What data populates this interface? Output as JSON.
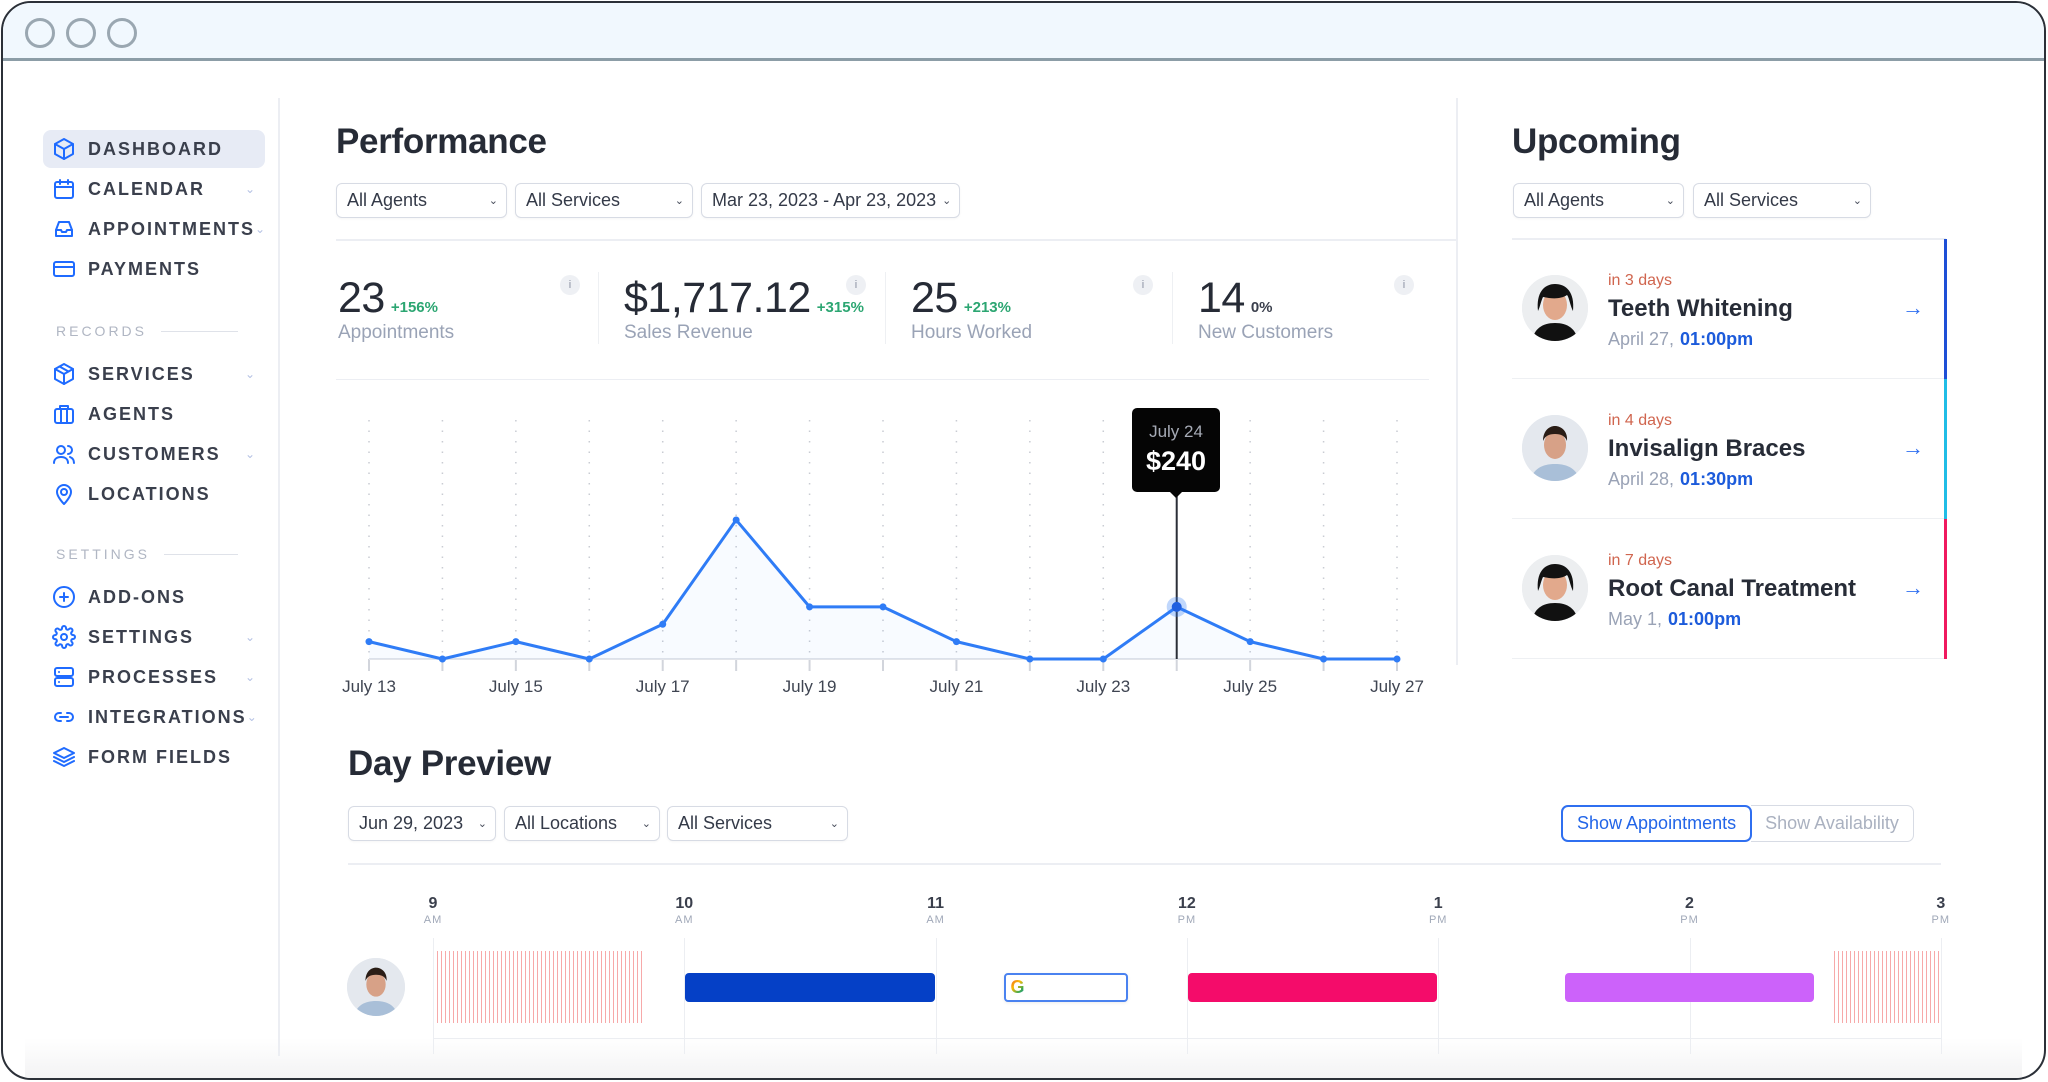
{
  "window": {
    "controls": [
      "close",
      "minimize",
      "maximize"
    ]
  },
  "sidebar": {
    "items": [
      {
        "label": "DASHBOARD",
        "icon": "cube-icon",
        "active": true,
        "has_submenu": false
      },
      {
        "label": "CALENDAR",
        "icon": "calendar-icon",
        "active": false,
        "has_submenu": true
      },
      {
        "label": "APPOINTMENTS",
        "icon": "inbox-icon",
        "active": false,
        "has_submenu": true
      },
      {
        "label": "PAYMENTS",
        "icon": "credit-card-icon",
        "active": false,
        "has_submenu": false
      }
    ],
    "records_heading": "RECORDS",
    "records_items": [
      {
        "label": "SERVICES",
        "icon": "box-icon",
        "has_submenu": true
      },
      {
        "label": "AGENTS",
        "icon": "briefcase-icon",
        "has_submenu": false
      },
      {
        "label": "CUSTOMERS",
        "icon": "users-icon",
        "has_submenu": true
      },
      {
        "label": "LOCATIONS",
        "icon": "map-pin-icon",
        "has_submenu": false
      }
    ],
    "settings_heading": "SETTINGS",
    "settings_items": [
      {
        "label": "ADD-ONS",
        "icon": "plus-circle-icon",
        "has_submenu": false
      },
      {
        "label": "SETTINGS",
        "icon": "gear-icon",
        "has_submenu": true
      },
      {
        "label": "PROCESSES",
        "icon": "server-icon",
        "has_submenu": true
      },
      {
        "label": "INTEGRATIONS",
        "icon": "link-icon",
        "has_submenu": true
      },
      {
        "label": "FORM FIELDS",
        "icon": "layers-icon",
        "has_submenu": false
      }
    ]
  },
  "performance": {
    "title": "Performance",
    "filters": {
      "agents": "All Agents",
      "services": "All Services",
      "date_range": "Mar 23, 2023 - Apr 23, 2023"
    },
    "stats": [
      {
        "value": "23",
        "delta": "+156%",
        "label": "Appointments",
        "delta_type": "positive"
      },
      {
        "value": "$1,717.12",
        "delta": "+315%",
        "label": "Sales Revenue",
        "delta_type": "positive"
      },
      {
        "value": "25",
        "delta": "+213%",
        "label": "Hours Worked",
        "delta_type": "positive"
      },
      {
        "value": "14",
        "delta": "0%",
        "label": "New Customers",
        "delta_type": "neutral"
      }
    ],
    "info_icon_label": "i",
    "tooltip": {
      "date": "July 24",
      "value": "$240"
    }
  },
  "chart_data": {
    "type": "line",
    "title": "",
    "xlabel": "",
    "ylabel": "",
    "x": [
      "July 13",
      "July 14",
      "July 15",
      "July 16",
      "July 17",
      "July 18",
      "July 19",
      "July 20",
      "July 21",
      "July 22",
      "July 23",
      "July 24",
      "July 25",
      "July 26",
      "July 27"
    ],
    "tick_labels": [
      "July 13",
      "July 15",
      "July 17",
      "July 19",
      "July 21",
      "July 23",
      "July 25",
      "July 27"
    ],
    "series": [
      {
        "name": "Sales Revenue",
        "values": [
          80,
          0,
          80,
          0,
          160,
          640,
          240,
          240,
          80,
          0,
          0,
          240,
          80,
          0,
          0
        ],
        "color": "#2f7cf6"
      }
    ],
    "ylim": [
      0,
      1100
    ],
    "grid": "vertical-dotted",
    "highlighted_point": {
      "x": "July 24",
      "value": 240
    }
  },
  "upcoming": {
    "title": "Upcoming",
    "filters": {
      "agents": "All Agents",
      "services": "All Services"
    },
    "items": [
      {
        "relative": "in 3 days",
        "service": "Teeth Whitening",
        "date": "April 27,",
        "time": "01:00pm",
        "color": "#1e4fd6",
        "avatar": "agent-long-hair"
      },
      {
        "relative": "in 4 days",
        "service": "Invisalign Braces",
        "date": "April 28,",
        "time": "01:30pm",
        "color": "#20bde6",
        "avatar": "agent-short-hair"
      },
      {
        "relative": "in 7 days",
        "service": "Root Canal Treatment",
        "date": "May 1,",
        "time": "01:00pm",
        "color": "#f0195f",
        "avatar": "agent-long-hair"
      }
    ]
  },
  "day_preview": {
    "title": "Day Preview",
    "filters": {
      "date": "Jun 29, 2023",
      "locations": "All Locations",
      "services": "All Services"
    },
    "toggle": {
      "appointments": "Show Appointments",
      "availability": "Show Availability",
      "active": "appointments"
    },
    "hours": [
      {
        "num": "9",
        "ampm": "AM"
      },
      {
        "num": "10",
        "ampm": "AM"
      },
      {
        "num": "11",
        "ampm": "AM"
      },
      {
        "num": "12",
        "ampm": "PM"
      },
      {
        "num": "1",
        "ampm": "PM"
      },
      {
        "num": "2",
        "ampm": "PM"
      },
      {
        "num": "3",
        "ampm": "PM"
      }
    ],
    "blocks": [
      {
        "kind": "unavailable",
        "start": 9.0,
        "end": 9.83
      },
      {
        "kind": "appointment",
        "start": 10.0,
        "end": 11.0,
        "color": "#0540c6"
      },
      {
        "kind": "google-event",
        "start": 11.27,
        "end": 11.77
      },
      {
        "kind": "appointment",
        "start": 12.0,
        "end": 13.0,
        "color": "#f40c6a"
      },
      {
        "kind": "appointment",
        "start": 13.5,
        "end": 14.5,
        "color": "#cc62fa"
      },
      {
        "kind": "unavailable",
        "start": 14.57,
        "end": 15.0
      }
    ],
    "google_icon_label": "G"
  }
}
